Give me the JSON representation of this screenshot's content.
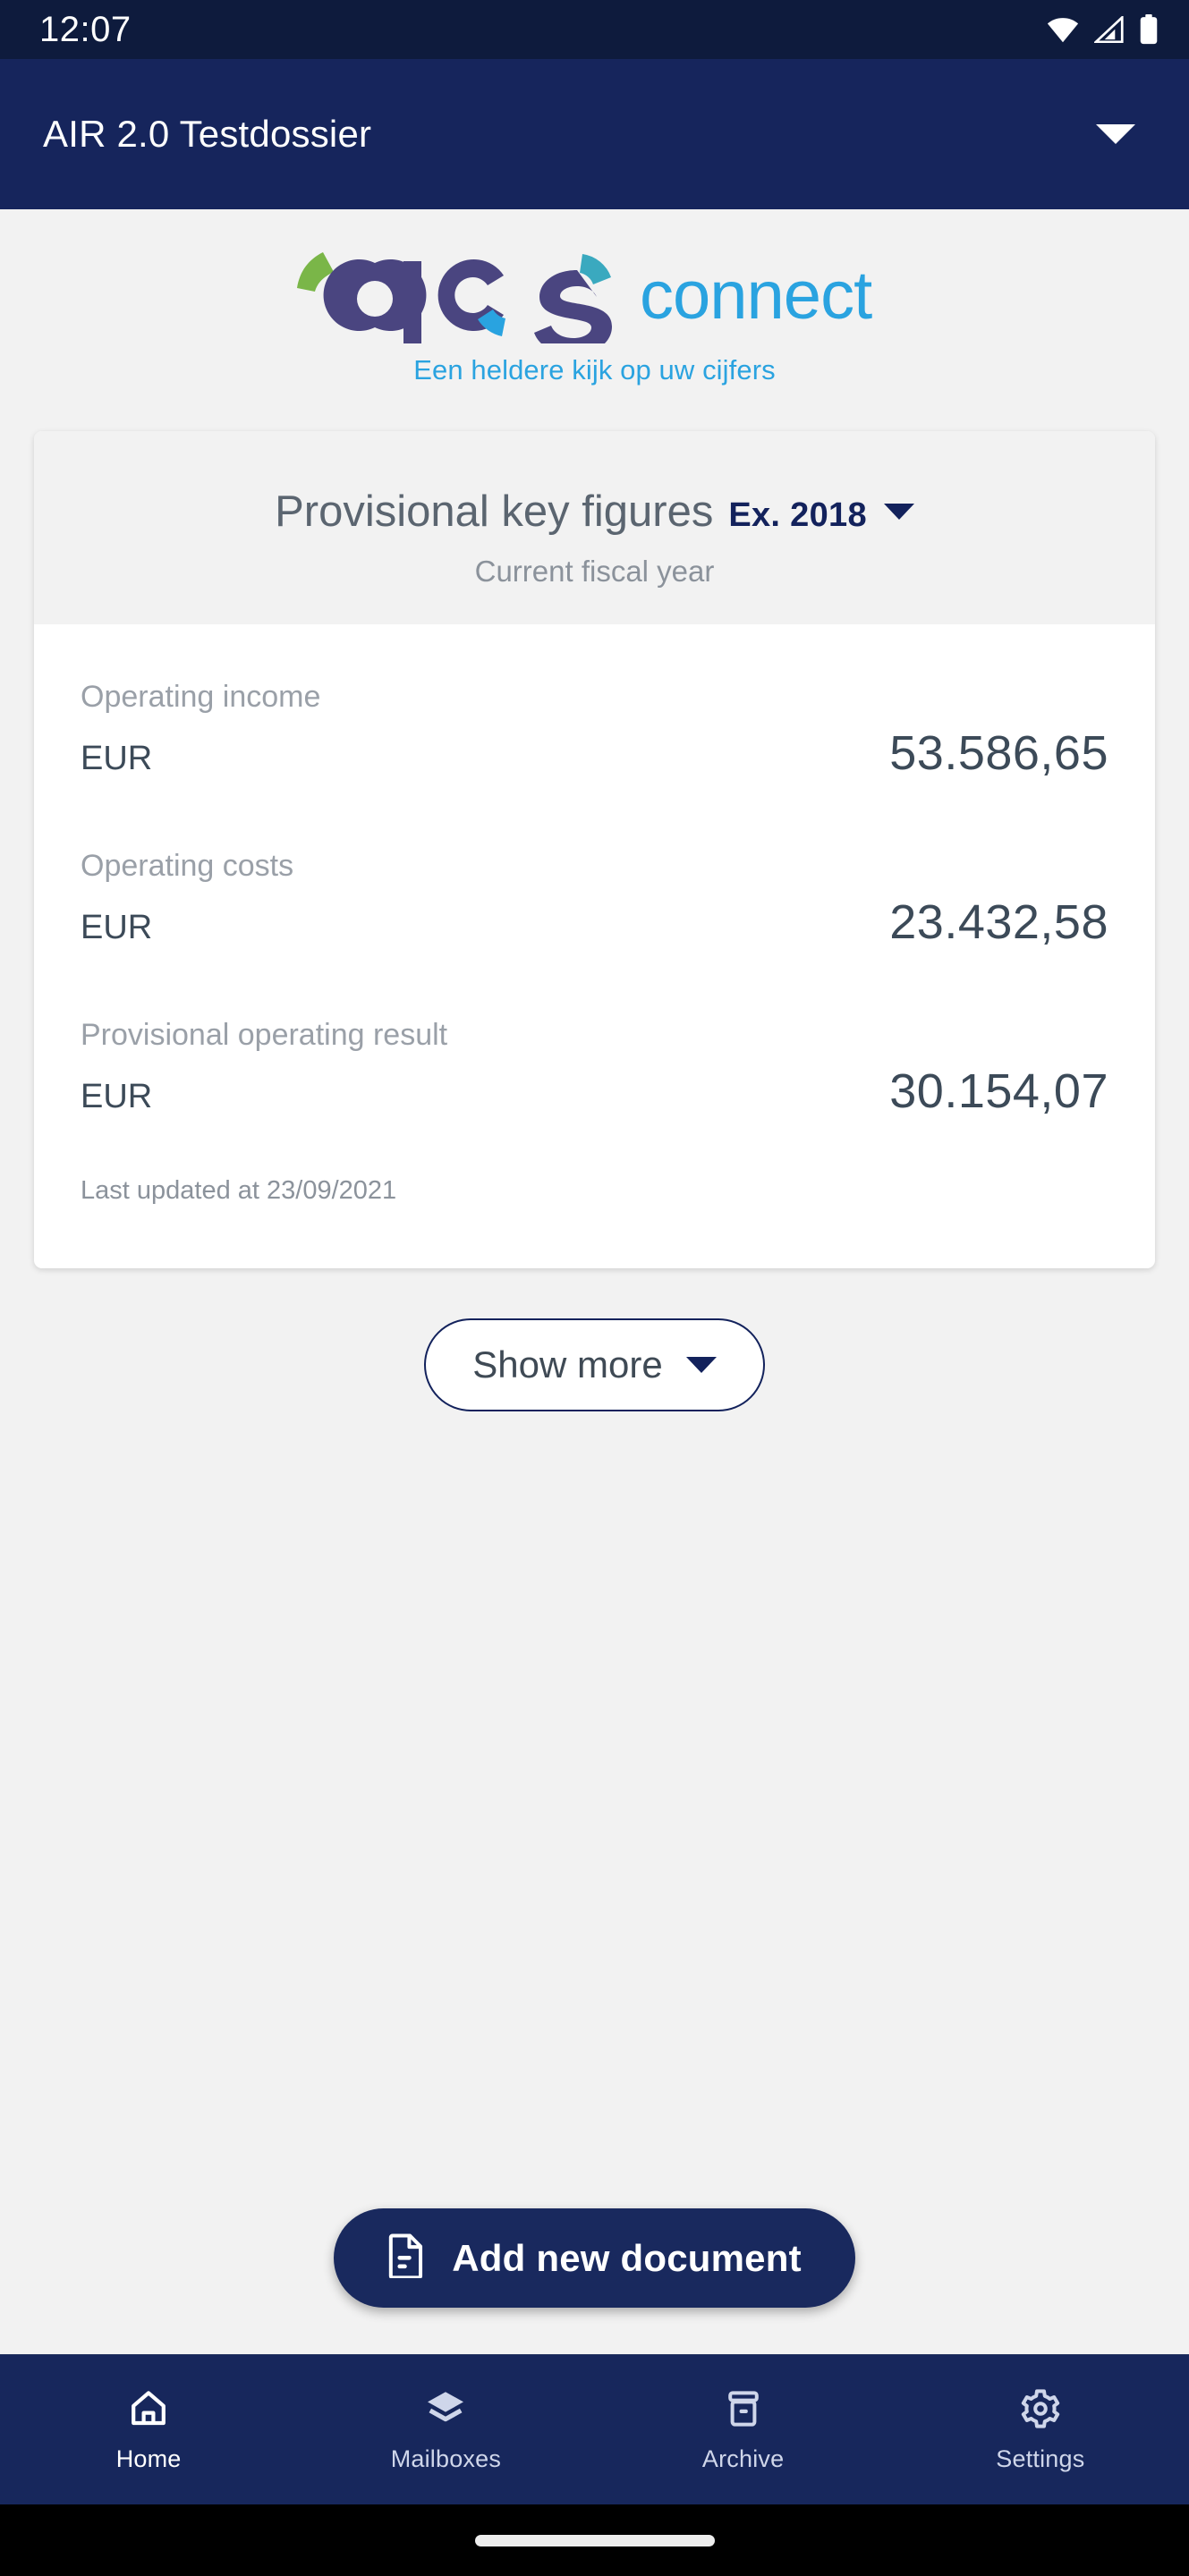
{
  "status_bar": {
    "time": "12:07",
    "icons": [
      "wifi-icon",
      "cellular-signal-icon",
      "battery-icon"
    ]
  },
  "app_bar": {
    "title": "AIR 2.0 Testdossier",
    "dropdown_icon": "chevron-down-icon"
  },
  "brand": {
    "logo_text_primary": "acs",
    "logo_text_secondary": "connect",
    "tagline": "Een heldere kijk op uw cijfers",
    "colors": {
      "purple": "#4a4580",
      "green": "#7ab648",
      "teal": "#3aa9bf",
      "blue": "#29a3e0",
      "connect_blue": "#2aa3e0"
    }
  },
  "card": {
    "title": "Provisional key figures",
    "period": "Ex. 2018",
    "period_caret_icon": "caret-down-icon",
    "subtitle": "Current fiscal year",
    "rows": [
      {
        "label": "Operating income",
        "currency": "EUR",
        "value": "53.586,65"
      },
      {
        "label": "Operating costs",
        "currency": "EUR",
        "value": "23.432,58"
      },
      {
        "label": "Provisional operating result",
        "currency": "EUR",
        "value": "30.154,07"
      }
    ],
    "last_updated": "Last updated at 23/09/2021"
  },
  "show_more": {
    "label": "Show more",
    "caret_icon": "caret-down-icon"
  },
  "fab": {
    "label": "Add new document",
    "icon": "document-icon",
    "color": "#19295e"
  },
  "bottom_nav": {
    "items": [
      {
        "label": "Home",
        "icon": "home-icon",
        "active": true
      },
      {
        "label": "Mailboxes",
        "icon": "layers-icon",
        "active": false
      },
      {
        "label": "Archive",
        "icon": "archive-box-icon",
        "active": false
      },
      {
        "label": "Settings",
        "icon": "gear-icon",
        "active": false
      }
    ]
  },
  "theme": {
    "status_bar_bg": "#0e1b3d",
    "app_bar_bg": "#16255c",
    "page_bg": "#f2f2f2",
    "card_bg": "#ffffff",
    "navy": "#13225c"
  }
}
